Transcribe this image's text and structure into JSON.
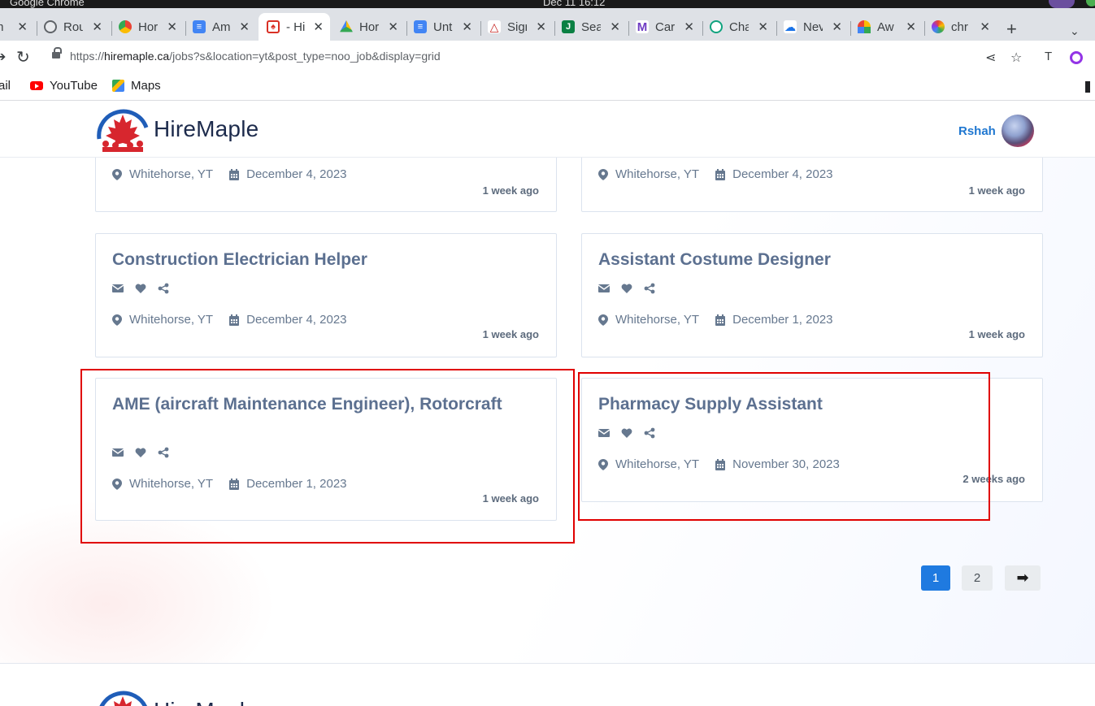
{
  "os": {
    "app_name": "Google Chrome",
    "clock": "Dec 11  16:12"
  },
  "tabs": [
    {
      "label": "m",
      "icon": "gmail-icon",
      "color": "#ea4335",
      "active": false
    },
    {
      "label": "Rou",
      "icon": "route-icon",
      "color": "#5f6368",
      "active": false
    },
    {
      "label": "Hor",
      "icon": "chrome-icon",
      "color": "#fbbc04",
      "active": false
    },
    {
      "label": "Am",
      "icon": "docs-icon",
      "color": "#4285f4",
      "active": false
    },
    {
      "label": "- Hi",
      "icon": "hiremaple-icon",
      "color": "#d93025",
      "active": true
    },
    {
      "label": "Hor",
      "icon": "drive-icon",
      "color": "#34a853",
      "active": false
    },
    {
      "label": "Unt",
      "icon": "docs-icon",
      "color": "#4285f4",
      "active": false
    },
    {
      "label": "Sigr",
      "icon": "signature-icon",
      "color": "#c5221f",
      "active": false
    },
    {
      "label": "Sea",
      "icon": "jobbank-icon",
      "color": "#0b8043",
      "active": false
    },
    {
      "label": "Car",
      "icon": "m-icon",
      "color": "#6f3cc3",
      "active": false
    },
    {
      "label": "Cha",
      "icon": "chatgpt-icon",
      "color": "#10a37f",
      "active": false
    },
    {
      "label": "Nev",
      "icon": "cloud-icon",
      "color": "#1a73e8",
      "active": false
    },
    {
      "label": "Aw",
      "icon": "rainbow-icon",
      "color": "#f29900",
      "active": false
    },
    {
      "label": "chr",
      "icon": "color-icon",
      "color": "#9334e6",
      "active": false
    }
  ],
  "address": {
    "url_prefix": "https://",
    "url_host": "hiremaple.ca",
    "url_path": "/jobs?s&location=yt&post_type=noo_job&display=grid"
  },
  "bookmarks": {
    "gmail": "ail",
    "youtube": "YouTube",
    "maps": "Maps"
  },
  "site": {
    "brand": "HireMaple",
    "user": "Rshah"
  },
  "jobs": [
    {
      "title": "",
      "location": "Whitehorse, YT",
      "date": "December 4, 2023",
      "ago": "1 week ago"
    },
    {
      "title": "",
      "location": "Whitehorse, YT",
      "date": "December 4, 2023",
      "ago": "1 week ago"
    },
    {
      "title": "Construction Electrician Helper",
      "location": "Whitehorse, YT",
      "date": "December 4, 2023",
      "ago": "1 week ago"
    },
    {
      "title": "Assistant Costume Designer",
      "location": "Whitehorse, YT",
      "date": "December 1, 2023",
      "ago": "1 week ago"
    },
    {
      "title": "AME (aircraft Maintenance Engineer), Rotorcraft",
      "location": "Whitehorse, YT",
      "date": "December 1, 2023",
      "ago": "1 week ago"
    },
    {
      "title": "Pharmacy Supply Assistant",
      "location": "Whitehorse, YT",
      "date": "November 30, 2023",
      "ago": "2 weeks ago"
    }
  ],
  "pagination": {
    "page1": "1",
    "page2": "2",
    "next": "➡"
  },
  "colors": {
    "accent": "#1f7ae0",
    "title": "#5c7090",
    "highlight": "#e00000"
  }
}
